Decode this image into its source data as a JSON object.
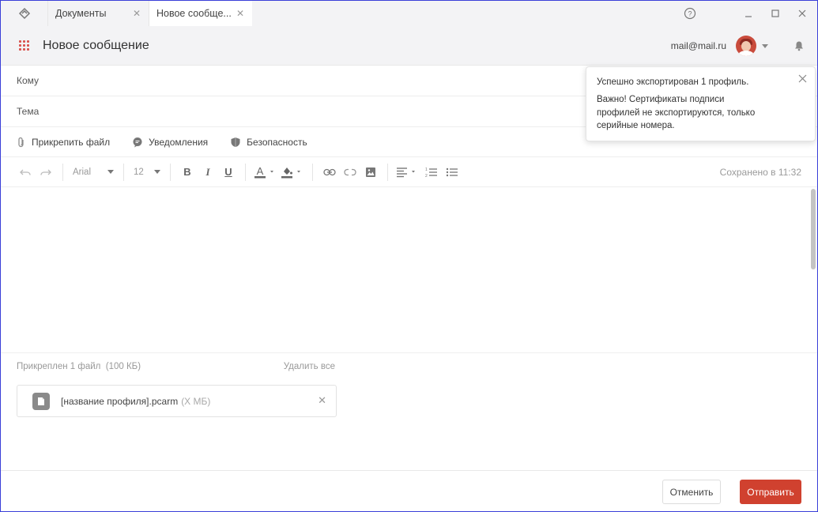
{
  "tabs": [
    {
      "label": "Документы",
      "active": false
    },
    {
      "label": "Новое сообще...",
      "active": true
    }
  ],
  "window_controls": {
    "help": "?",
    "minimize": "–",
    "maximize": "□",
    "close": "✕"
  },
  "header": {
    "title": "Новое сообщение",
    "email": "mail@mail.ru"
  },
  "fields": {
    "to_label": "Кому",
    "subject_label": "Тема"
  },
  "options": {
    "attach": "Прикрепить файл",
    "notifications": "Уведомления",
    "security": "Безопасность"
  },
  "toolbar": {
    "font": "Arial",
    "size": "12",
    "saved_status": "Сохранено в 11:32"
  },
  "attachments": {
    "summary": "Прикреплен 1 файл",
    "summary_size": "(100 КБ)",
    "remove_all": "Удалить все",
    "files": [
      {
        "name": "[название профиля].pcarm",
        "size": "(X МБ)"
      }
    ]
  },
  "footer": {
    "cancel": "Отменить",
    "send": "Отправить"
  },
  "toast": {
    "title": "Успешно экспортирован 1 профиль.",
    "body": "Важно! Сертификаты подписи профилей не экспортируются, только серийные номера."
  },
  "colors": {
    "accent": "#d0412f",
    "window_border": "#3a3fd8"
  }
}
